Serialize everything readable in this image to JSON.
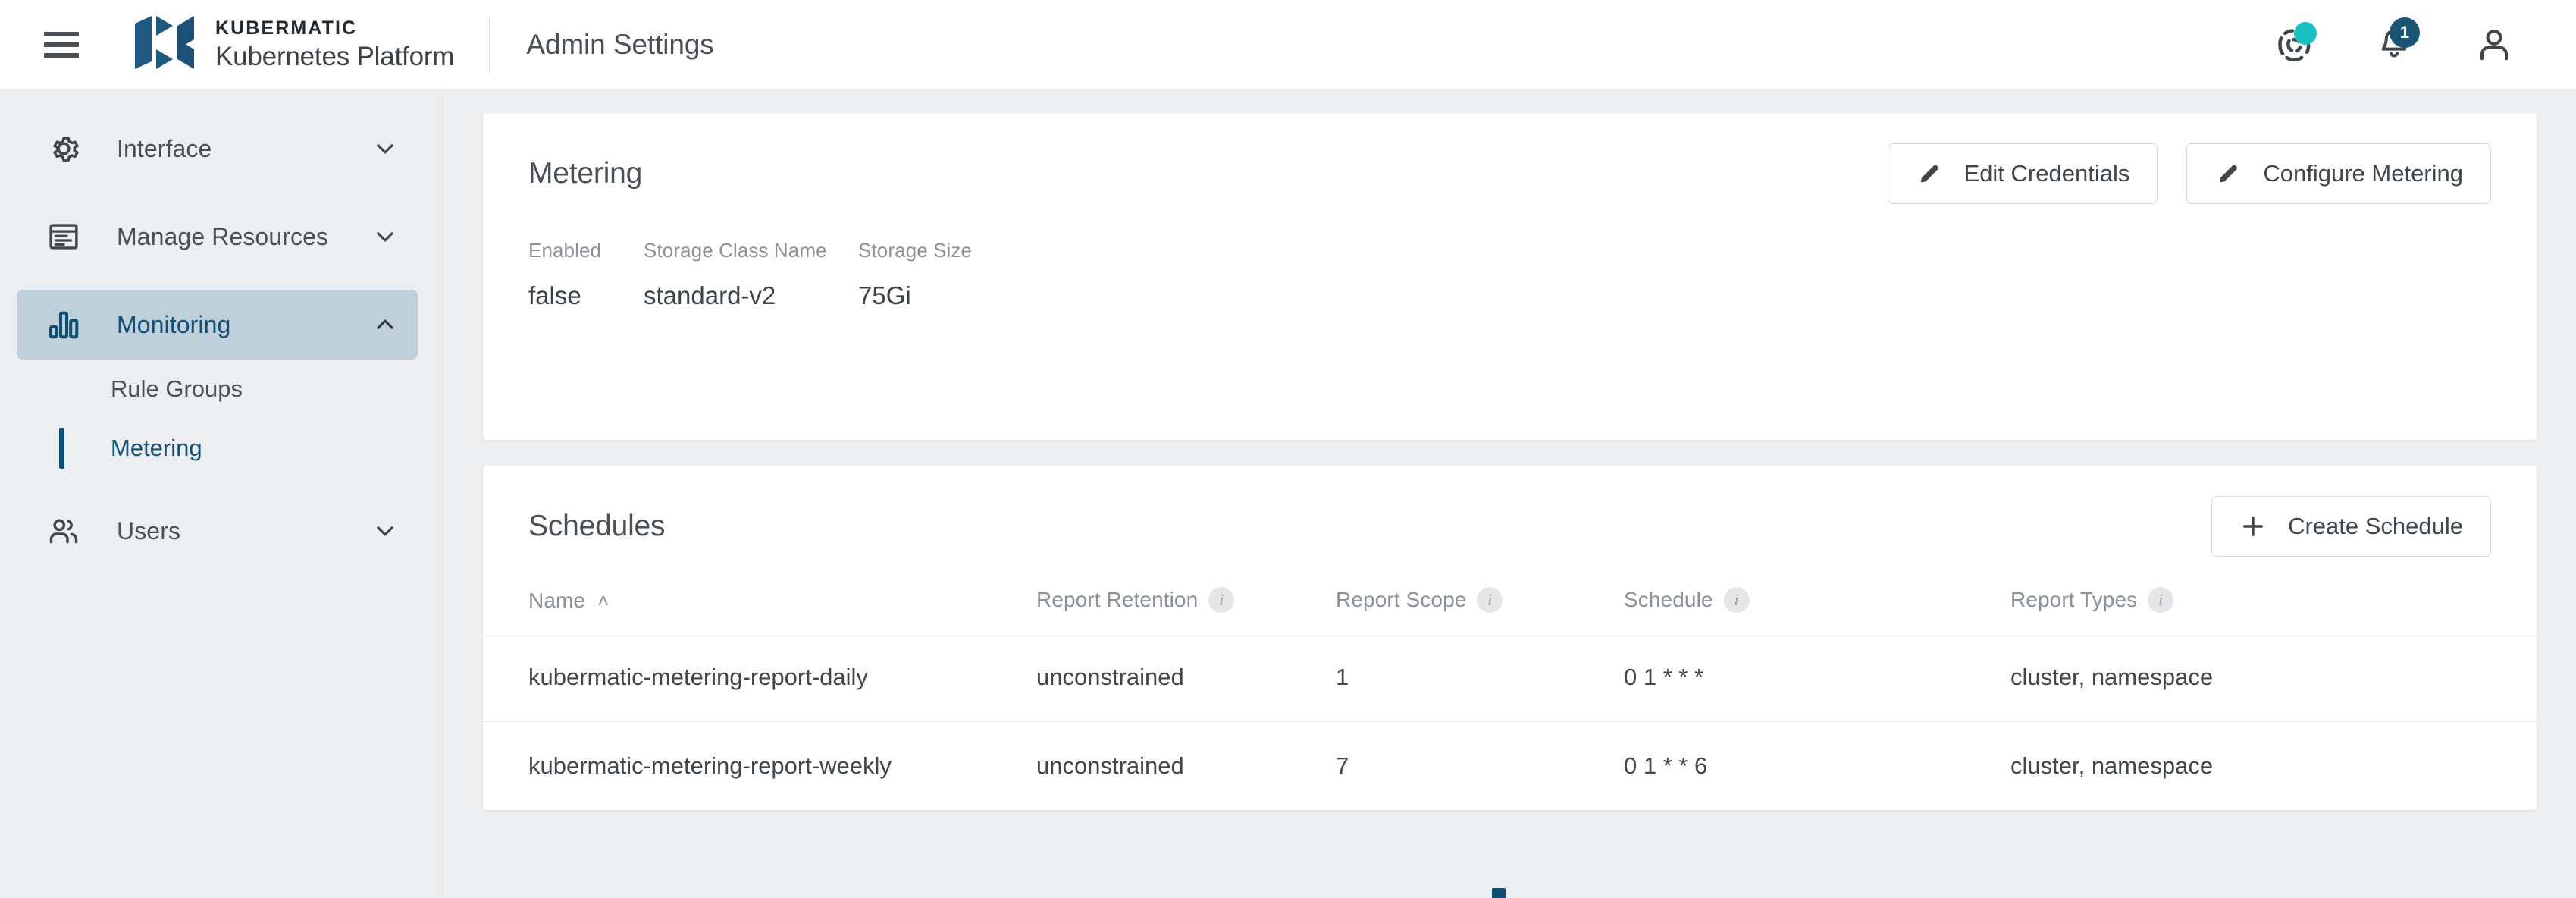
{
  "topbar": {
    "menu_icon": "hamburger-menu-icon",
    "brand_top": "KUBERMATIC",
    "brand_bottom": "Kubernetes Platform",
    "page_title": "Admin Settings",
    "help_icon": "help-support-icon",
    "help_badge_color": "#18c1c1",
    "notifications_icon": "bell-icon",
    "notifications_count": "1",
    "notifications_badge_color": "#1a5475",
    "account_icon": "user-account-icon"
  },
  "sidebar": {
    "items": [
      {
        "label": "Interface",
        "icon": "gear-icon",
        "chevron": "chevron-down-icon",
        "active": false
      },
      {
        "label": "Manage Resources",
        "icon": "list-rows-icon",
        "chevron": "chevron-down-icon",
        "active": false
      },
      {
        "label": "Monitoring",
        "icon": "bar-chart-icon",
        "chevron": "chevron-up-icon",
        "active": true
      },
      {
        "label": "Users",
        "icon": "users-icon",
        "chevron": "chevron-down-icon",
        "active": false
      }
    ],
    "submenu": [
      {
        "label": "Rule Groups",
        "active": false
      },
      {
        "label": "Metering",
        "active": true
      }
    ],
    "active_color": "#115077",
    "active_bg": "#bfd0da"
  },
  "metering_card": {
    "title": "Metering",
    "buttons": [
      {
        "label": "Edit Credentials",
        "icon": "pencil-icon"
      },
      {
        "label": "Configure Metering",
        "icon": "pencil-icon"
      }
    ],
    "stats": [
      {
        "label": "Enabled",
        "value": "false"
      },
      {
        "label": "Storage Class Name",
        "value": "standard-v2"
      },
      {
        "label": "Storage Size",
        "value": "75Gi"
      }
    ]
  },
  "schedules_card": {
    "title": "Schedules",
    "create_button": {
      "label": "Create Schedule",
      "icon": "plus-icon"
    },
    "columns": [
      {
        "label": "Name",
        "sort": "˄",
        "info": false
      },
      {
        "label": "Report Retention",
        "info": true
      },
      {
        "label": "Report Scope",
        "info": true
      },
      {
        "label": "Schedule",
        "info": true
      },
      {
        "label": "Report Types",
        "info": true
      }
    ],
    "rows": [
      {
        "name": "kubermatic-metering-report-daily",
        "retention": "unconstrained",
        "scope": "1",
        "schedule": "0 1 * * *",
        "types": "cluster, namespace"
      },
      {
        "name": "kubermatic-metering-report-weekly",
        "retention": "unconstrained",
        "scope": "7",
        "schedule": "0 1 * * 6",
        "types": "cluster, namespace"
      }
    ]
  }
}
